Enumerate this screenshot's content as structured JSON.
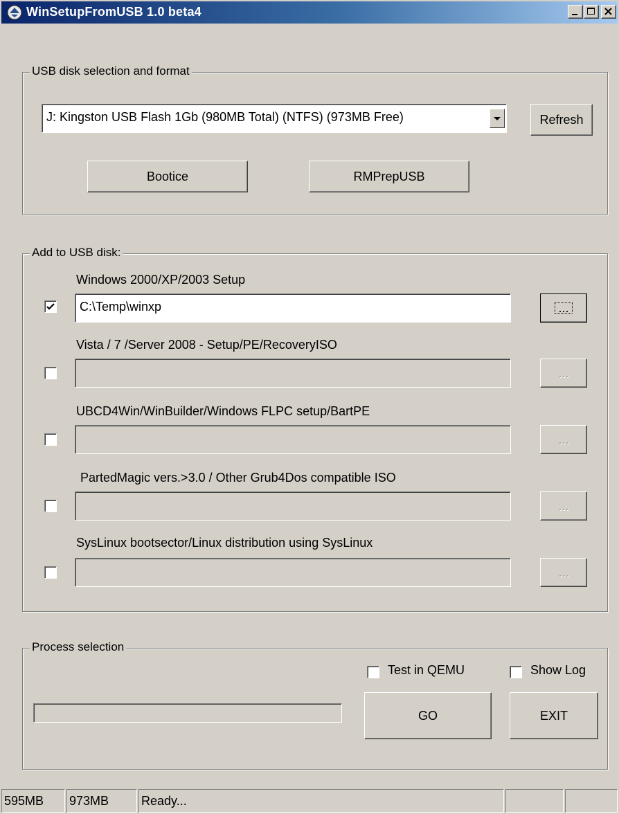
{
  "window": {
    "title": "WinSetupFromUSB 1.0 beta4",
    "title_gradient_start": "#0a246a",
    "title_gradient_end": "#a6caf0",
    "face_color": "#d4d0c8"
  },
  "usb_group": {
    "title": "USB disk selection and format",
    "disk_selected": "J: Kingston USB Flash 1Gb (980MB Total) (NTFS) (973MB Free)",
    "refresh_label": "Refresh",
    "bootice_label": "Bootice",
    "rmprep_label": "RMPrepUSB"
  },
  "add_group": {
    "title": "Add to USB disk:",
    "browse_label": "...",
    "items": [
      {
        "label": "Windows 2000/XP/2003 Setup",
        "checked": true,
        "path": "C:\\Temp\\winxp",
        "enabled": true
      },
      {
        "label": "Vista / 7 /Server 2008 - Setup/PE/RecoveryISO",
        "checked": false,
        "path": "",
        "enabled": false
      },
      {
        "label": "UBCD4Win/WinBuilder/Windows FLPC setup/BartPE",
        "checked": false,
        "path": "",
        "enabled": false
      },
      {
        "label": "PartedMagic vers.>3.0 / Other Grub4Dos compatible ISO",
        "checked": false,
        "path": "",
        "enabled": false
      },
      {
        "label": "SysLinux bootsector/Linux distribution using SysLinux",
        "checked": false,
        "path": "",
        "enabled": false
      }
    ]
  },
  "process_group": {
    "title": "Process selection",
    "test_qemu_label": "Test in QEMU",
    "test_qemu_checked": false,
    "show_log_label": "Show Log",
    "show_log_checked": false,
    "go_label": "GO",
    "exit_label": "EXIT",
    "progress": 0
  },
  "status_bar": {
    "pane1": "595MB",
    "pane2": "973MB",
    "pane3": "Ready...",
    "pane4": "",
    "pane5": ""
  },
  "icons": {
    "app": "app-logo-icon",
    "minimize": "minimize-icon",
    "maximize": "maximize-icon",
    "close": "close-icon",
    "dropdown": "chevron-down-icon",
    "check": "checkmark-icon"
  }
}
